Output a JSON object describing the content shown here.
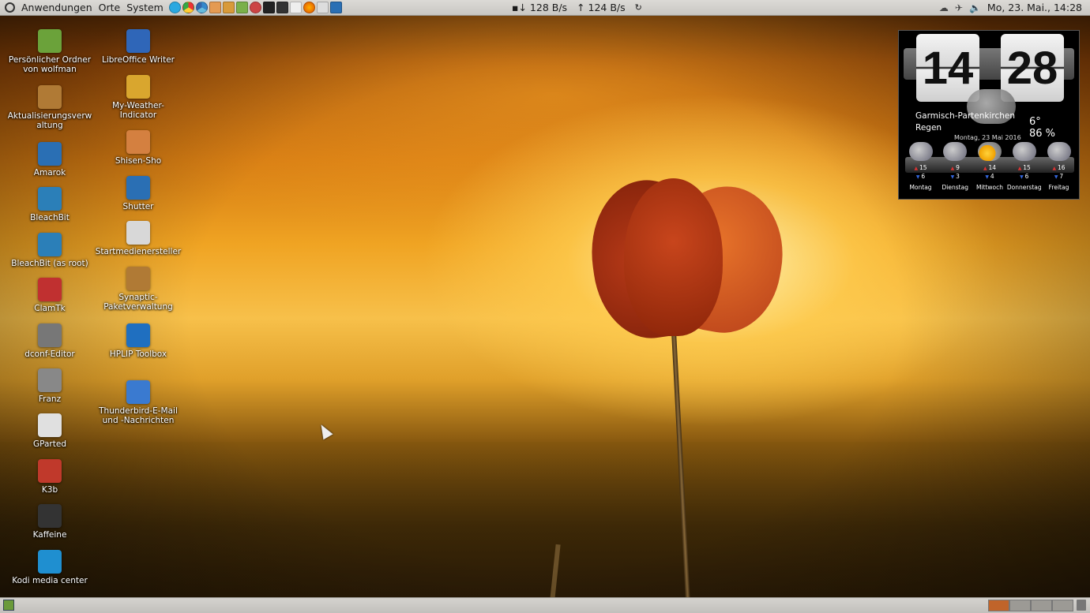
{
  "top_panel": {
    "menus": [
      "Anwendungen",
      "Orte",
      "System"
    ],
    "net_down": "128 B/s",
    "net_up": "124 B/s",
    "datetime": "Mo, 23. Mai., 14:28",
    "launchers": [
      "skype-icon",
      "chrome-icon",
      "chrome-beta-icon",
      "shisen-icon",
      "flower-icon",
      "audio-icon",
      "ring-icon",
      "terminal-icon",
      "monitor-icon",
      "window-icon",
      "firefox-icon",
      "screen-icon",
      "shutter-icon"
    ]
  },
  "desktop": {
    "col1": [
      {
        "name": "home-folder",
        "label": "Persönlicher Ordner\nvon wolfman",
        "color": "#6ba23a"
      },
      {
        "name": "update-manager",
        "label": "Aktualisierungsverw\naltung",
        "color": "#b07a35"
      },
      {
        "name": "amarok",
        "label": "Amarok",
        "color": "#2a6fb4"
      },
      {
        "name": "bleachbit",
        "label": "BleachBit",
        "color": "#2b7fb8"
      },
      {
        "name": "bleachbit-root",
        "label": "BleachBit (as root)",
        "color": "#2b7fb8"
      },
      {
        "name": "clamtk",
        "label": "ClamTk",
        "color": "#c03030"
      },
      {
        "name": "dconf-editor",
        "label": "dconf-Editor",
        "color": "#777"
      },
      {
        "name": "franz",
        "label": "Franz",
        "color": "#888"
      },
      {
        "name": "gparted",
        "label": "GParted",
        "color": "#e0e0e0"
      },
      {
        "name": "k3b",
        "label": "K3b",
        "color": "#c0392b"
      },
      {
        "name": "kaffeine",
        "label": "Kaffeine",
        "color": "#333"
      },
      {
        "name": "kodi",
        "label": "Kodi media center",
        "color": "#1f8fd0"
      }
    ],
    "col2": [
      {
        "name": "libreoffice-writer",
        "label": "LibreOffice Writer",
        "color": "#2f66b8"
      },
      {
        "name": "my-weather-indicator",
        "label": "My-Weather-\nIndicator",
        "color": "#d9a62e"
      },
      {
        "name": "shisen-sho",
        "label": "Shisen-Sho",
        "color": "#d48040"
      },
      {
        "name": "shutter",
        "label": "Shutter",
        "color": "#2a6fb4"
      },
      {
        "name": "startup-disk-creator",
        "label": "Startmedienersteller",
        "color": "#d8d8d8"
      },
      {
        "name": "synaptic",
        "label": "Synaptic-\nPaketverwaltung",
        "color": "#b07a35"
      },
      {
        "name": "hplip-toolbox",
        "label": "HPLIP Toolbox",
        "color": "#1f6fc0"
      },
      {
        "name": "thunderbird",
        "label": "Thunderbird-E-Mail\nund -Nachrichten",
        "color": "#3a7ad0"
      }
    ]
  },
  "clock_widget": {
    "hour": "14",
    "minute": "28",
    "city": "Garmisch-Partenkirchen",
    "condition": "Regen",
    "date": "Montag, 23 Mai 2016",
    "temperature": "6°",
    "humidity": "86 %",
    "forecast": [
      {
        "day": "Montag",
        "high": "15",
        "low": "6",
        "icon": "snow-icon"
      },
      {
        "day": "Dienstag",
        "high": "9",
        "low": "3",
        "icon": "snow-icon"
      },
      {
        "day": "Mittwoch",
        "high": "14",
        "low": "4",
        "icon": "sun-cloud-icon"
      },
      {
        "day": "Donnerstag",
        "high": "15",
        "low": "6",
        "icon": "rain-icon"
      },
      {
        "day": "Freitag",
        "high": "16",
        "low": "7",
        "icon": "rain-icon"
      }
    ]
  },
  "colors": {
    "panel": "#d3d1cd",
    "accent_workspace": "#c0642a"
  }
}
